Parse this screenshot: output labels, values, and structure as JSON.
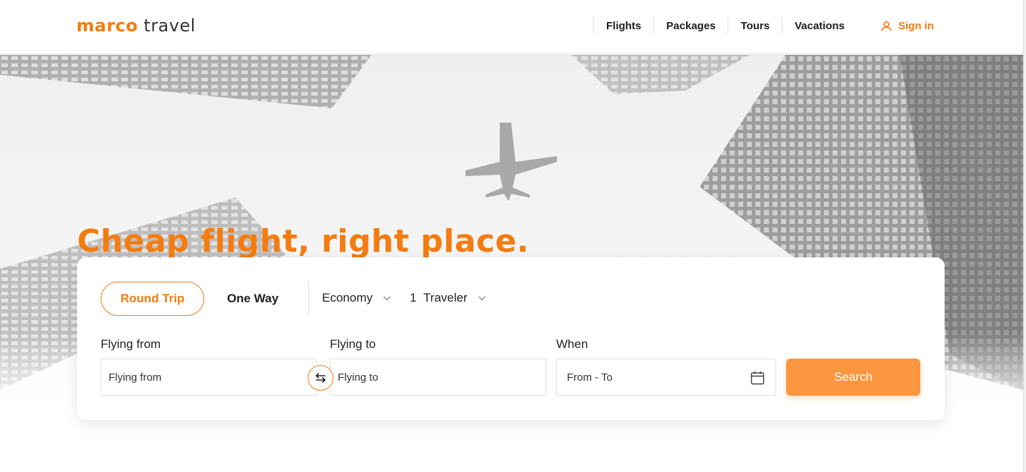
{
  "colors": {
    "accent": "#f47c10",
    "search_button": "#fb9640"
  },
  "header": {
    "logo_brand": "marco",
    "logo_suffix": "travel",
    "nav": [
      "Flights",
      "Packages",
      "Tours",
      "Vacations"
    ],
    "signin_label": "Sign in",
    "signin_icon": "user-icon"
  },
  "hero": {
    "headline": "Cheap flight, right place."
  },
  "search": {
    "trip_types": {
      "round_trip": "Round Trip",
      "one_way": "One Way",
      "selected": "Round Trip"
    },
    "cabin_class": "Economy",
    "travelers_count": "1",
    "travelers_label": "Traveler",
    "from_label": "Flying from",
    "from_value": "Flying from",
    "to_label": "Flying to",
    "to_value": "Flying to",
    "when_label": "When",
    "when_value": "From - To",
    "swap_icon": "swap-arrows-icon",
    "calendar_icon": "calendar-icon",
    "submit_label": "Search"
  }
}
